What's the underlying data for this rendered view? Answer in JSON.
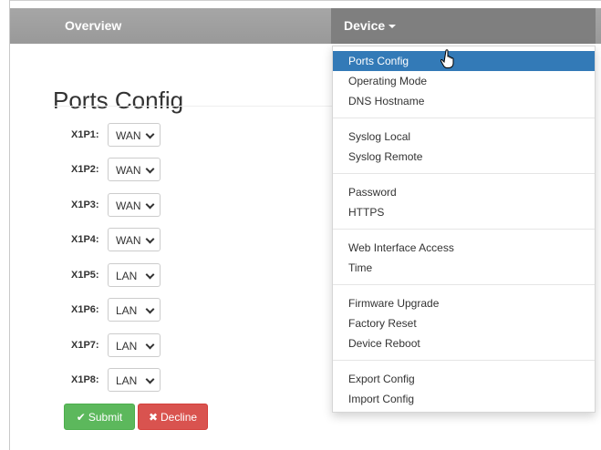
{
  "nav": {
    "overview": "Overview",
    "device": "Device"
  },
  "page": {
    "title": "Ports Config"
  },
  "ports": [
    {
      "label": "X1P1:",
      "value": "WAN"
    },
    {
      "label": "X1P2:",
      "value": "WAN"
    },
    {
      "label": "X1P3:",
      "value": "WAN"
    },
    {
      "label": "X1P4:",
      "value": "WAN"
    },
    {
      "label": "X1P5:",
      "value": "LAN"
    },
    {
      "label": "X1P6:",
      "value": "LAN"
    },
    {
      "label": "X1P7:",
      "value": "LAN"
    },
    {
      "label": "X1P8:",
      "value": "LAN"
    }
  ],
  "buttons": {
    "submit": "Submit",
    "decline": "Decline"
  },
  "menu": {
    "ports_config": "Ports Config",
    "operating_mode": "Operating Mode",
    "dns_hostname": "DNS Hostname",
    "syslog_local": "Syslog Local",
    "syslog_remote": "Syslog Remote",
    "password": "Password",
    "https": "HTTPS",
    "web_interface_access": "Web Interface Access",
    "time": "Time",
    "firmware_upgrade": "Firmware Upgrade",
    "factory_reset": "Factory Reset",
    "device_reboot": "Device Reboot",
    "export_config": "Export Config",
    "import_config": "Import Config"
  },
  "colors": {
    "navbar": "#999999",
    "nav_active": "#7f7f7f",
    "menu_active": "#337ab7",
    "submit": "#5cb85c",
    "decline": "#d9534f"
  },
  "icons": {
    "submit": "check-icon",
    "decline": "x-icon",
    "cursor": "hand-pointer-icon"
  }
}
